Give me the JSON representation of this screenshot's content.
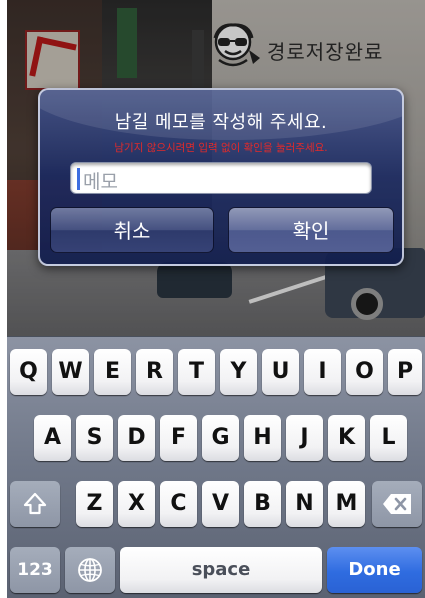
{
  "header": {
    "logo_text": "경로저장완료"
  },
  "alert": {
    "title": "남길 메모를 작성해 주세요.",
    "subtitle": "남기지 않으시려면 입력 없이 확인을 눌러주세요.",
    "input_placeholder": "메모",
    "input_value": "",
    "cancel_label": "취소",
    "ok_label": "확인"
  },
  "keyboard": {
    "row1": [
      "Q",
      "W",
      "E",
      "R",
      "T",
      "Y",
      "U",
      "I",
      "O",
      "P"
    ],
    "row2": [
      "A",
      "S",
      "D",
      "F",
      "G",
      "H",
      "J",
      "K",
      "L"
    ],
    "row3": [
      "Z",
      "X",
      "C",
      "V",
      "B",
      "N",
      "M"
    ],
    "shift_icon": "shift-arrow-icon",
    "delete_icon": "delete-backspace-icon",
    "numbers_label": "123",
    "globe_icon": "globe-icon",
    "space_label": "space",
    "done_label": "Done"
  },
  "colors": {
    "alert_subtitle": "#e22a2a",
    "done_key": "#2f6ce0"
  }
}
